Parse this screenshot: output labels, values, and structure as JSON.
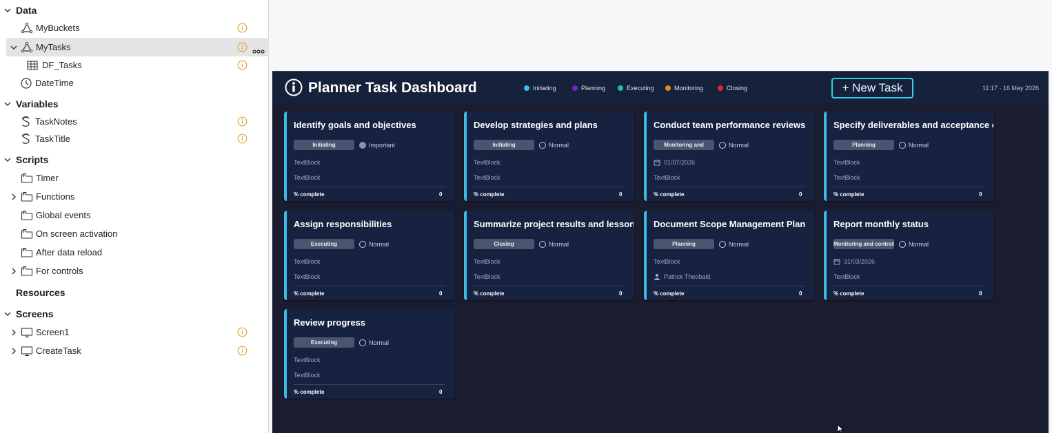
{
  "tree": {
    "sections": {
      "data": "Data",
      "variables": "Variables",
      "scripts": "Scripts",
      "resources": "Resources",
      "screens": "Screens"
    },
    "data_items": [
      "MyBuckets",
      "MyTasks",
      "DF_Tasks",
      "DateTime"
    ],
    "variable_items": [
      "TaskNotes",
      "TaskTitle"
    ],
    "script_items": [
      "Timer",
      "Functions",
      "Global events",
      "On screen activation",
      "After data reload",
      "For controls"
    ],
    "screen_items": [
      "Screen1",
      "CreateTask"
    ]
  },
  "dashboard": {
    "title": "Planner Task Dashboard",
    "legend": [
      {
        "label": "Initiating",
        "color": "#3bbde8"
      },
      {
        "label": "Planning",
        "color": "#7a22c7"
      },
      {
        "label": "Executing",
        "color": "#1fbf97"
      },
      {
        "label": "Monitoring",
        "color": "#e98a15"
      },
      {
        "label": "Closing",
        "color": "#e2243a"
      }
    ],
    "new_task_label": "+ New Task",
    "clock": "11:17  ·  16 May 2026",
    "percent_label": "% complete",
    "cards": [
      {
        "title": "Identify goals and objectives",
        "stage": "Initiating",
        "priority": "Important",
        "line1": "TextBlock",
        "line2": "TextBlock",
        "percent": "0"
      },
      {
        "title": "Develop strategies and plans",
        "stage": "Initiating",
        "priority": "Normal",
        "line1": "TextBlock",
        "line2": "TextBlock",
        "percent": "0"
      },
      {
        "title": "Conduct team performance reviews",
        "stage": "Monitoring and",
        "priority": "Normal",
        "line1": "01/07/2026",
        "line2": "TextBlock",
        "percent": "0"
      },
      {
        "title": "Specify deliverables and acceptance criteria",
        "stage": "Planning",
        "priority": "Normal",
        "line1": "TextBlock",
        "line2": "TextBlock",
        "percent": "0"
      },
      {
        "title": "Assign responsibilities",
        "stage": "Executing",
        "priority": "Normal",
        "line1": "TextBlock",
        "line2": "TextBlock",
        "percent": "0"
      },
      {
        "title": "Summarize project results and lessons learned",
        "stage": "Closing",
        "priority": "Normal",
        "line1": "TextBlock",
        "line2": "TextBlock",
        "percent": "0"
      },
      {
        "title": "Document Scope Management Plan",
        "stage": "Planning",
        "priority": "Normal",
        "line1": "TextBlock",
        "line2": "Patrick Theobald",
        "percent": "0"
      },
      {
        "title": "Report monthly status",
        "stage": "Monitoring and controlling",
        "priority": "Normal",
        "line1": "31/03/2026",
        "line2": "TextBlock",
        "percent": "0"
      },
      {
        "title": "Review progress",
        "stage": "Executing",
        "priority": "Normal",
        "line1": "TextBlock",
        "line2": "TextBlock",
        "percent": "0"
      }
    ]
  }
}
